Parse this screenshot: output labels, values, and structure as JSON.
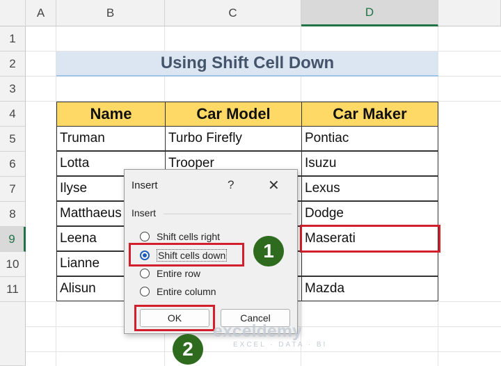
{
  "columns": [
    "A",
    "B",
    "C",
    "D"
  ],
  "rows": [
    "1",
    "2",
    "3",
    "4",
    "5",
    "6",
    "7",
    "8",
    "9",
    "10",
    "11"
  ],
  "title": "Using Shift Cell Down",
  "table": {
    "headers": [
      "Name",
      "Car Model",
      "Car Maker"
    ],
    "rows": [
      [
        "Truman",
        "Turbo Firefly",
        "Pontiac"
      ],
      [
        "Lotta",
        "Trooper",
        "Isuzu"
      ],
      [
        "Ilyse",
        "",
        "Lexus"
      ],
      [
        "Matthaeus",
        "",
        "Dodge"
      ],
      [
        "Leena",
        "",
        "Maserati"
      ],
      [
        "Lianne",
        "",
        ""
      ],
      [
        "Alisun",
        "",
        "Mazda"
      ]
    ]
  },
  "dialog": {
    "title": "Insert",
    "help": "?",
    "close": "✕",
    "group_label": "Insert",
    "options": [
      "Shift cells right",
      "Shift cells down",
      "Entire row",
      "Entire column"
    ],
    "selected": "Shift cells down",
    "ok": "OK",
    "cancel": "Cancel"
  },
  "steps": [
    "1",
    "2"
  ],
  "watermark": {
    "brand": "exceldemy",
    "tagline": "EXCEL · DATA · BI"
  },
  "colors": {
    "accent": "#217346",
    "highlight": "#d21f2b",
    "header_fill": "#ffd966",
    "badge": "#2e6b1f"
  }
}
